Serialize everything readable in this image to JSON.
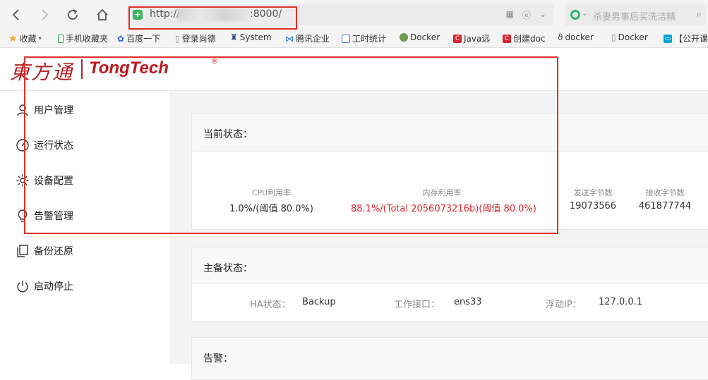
{
  "browser": {
    "url_prefix": "http://",
    "url_suffix": ":8000/",
    "search_placeholder": "杀妻男事后买洗洁精"
  },
  "bookmarks": [
    {
      "label": "收藏",
      "icon": "star-icon"
    },
    {
      "label": "手机收藏夹",
      "icon": "phone-icon"
    },
    {
      "label": "百度一下",
      "icon": "baidu-paw-icon"
    },
    {
      "label": "登录尚德",
      "icon": "page-icon"
    },
    {
      "label": "System",
      "icon": "figure-icon"
    },
    {
      "label": "腾讯企业",
      "icon": "tencent-icon"
    },
    {
      "label": "工时统计",
      "icon": "form-icon"
    },
    {
      "label": "Docker",
      "icon": "docker-icon"
    },
    {
      "label": "Java远",
      "icon": "csdn-icon"
    },
    {
      "label": "创建doc",
      "icon": "csdn-icon"
    },
    {
      "label": "docker",
      "icon": "hook-icon"
    },
    {
      "label": "Docker",
      "icon": "page-icon"
    },
    {
      "label": "【公开课",
      "icon": "bilibili-icon"
    }
  ],
  "logo": {
    "cn": "東方通",
    "en": "TongTech",
    "reg": "®"
  },
  "sidebar": {
    "items": [
      {
        "label": "用户管理",
        "icon": "user-icon"
      },
      {
        "label": "运行状态",
        "icon": "gauge-icon"
      },
      {
        "label": "设备配置",
        "icon": "gear-icon"
      },
      {
        "label": "告警管理",
        "icon": "bulb-icon"
      },
      {
        "label": "备份还原",
        "icon": "copy-icon"
      },
      {
        "label": "启动停止",
        "icon": "power-icon"
      }
    ]
  },
  "status_panel": {
    "title": "当前状态：",
    "stats": [
      {
        "label": "CPU利用率",
        "value": "1.0%/(阈值 80.0%)",
        "alert": false
      },
      {
        "label": "内存利用率",
        "value": "88.1%/(Total 2056073216b)(阈值 80.0%)",
        "alert": true
      },
      {
        "label": "发送字节数",
        "value": "19073566",
        "alert": false
      },
      {
        "label": "接收字节数",
        "value": "461877744",
        "alert": false
      }
    ]
  },
  "ha_panel": {
    "title": "主备状态：",
    "ha_label": "HA状态：",
    "ha_value": "Backup",
    "iface_label": "工作接口：",
    "iface_value": "ens33",
    "ip_label": "浮动IP：",
    "ip_value": "127.0.0.1"
  },
  "alarm_panel": {
    "title": "告警："
  },
  "colors": {
    "alert": "#d9262c",
    "brand": "#c0161c",
    "highlight_box": "#e0302a"
  }
}
